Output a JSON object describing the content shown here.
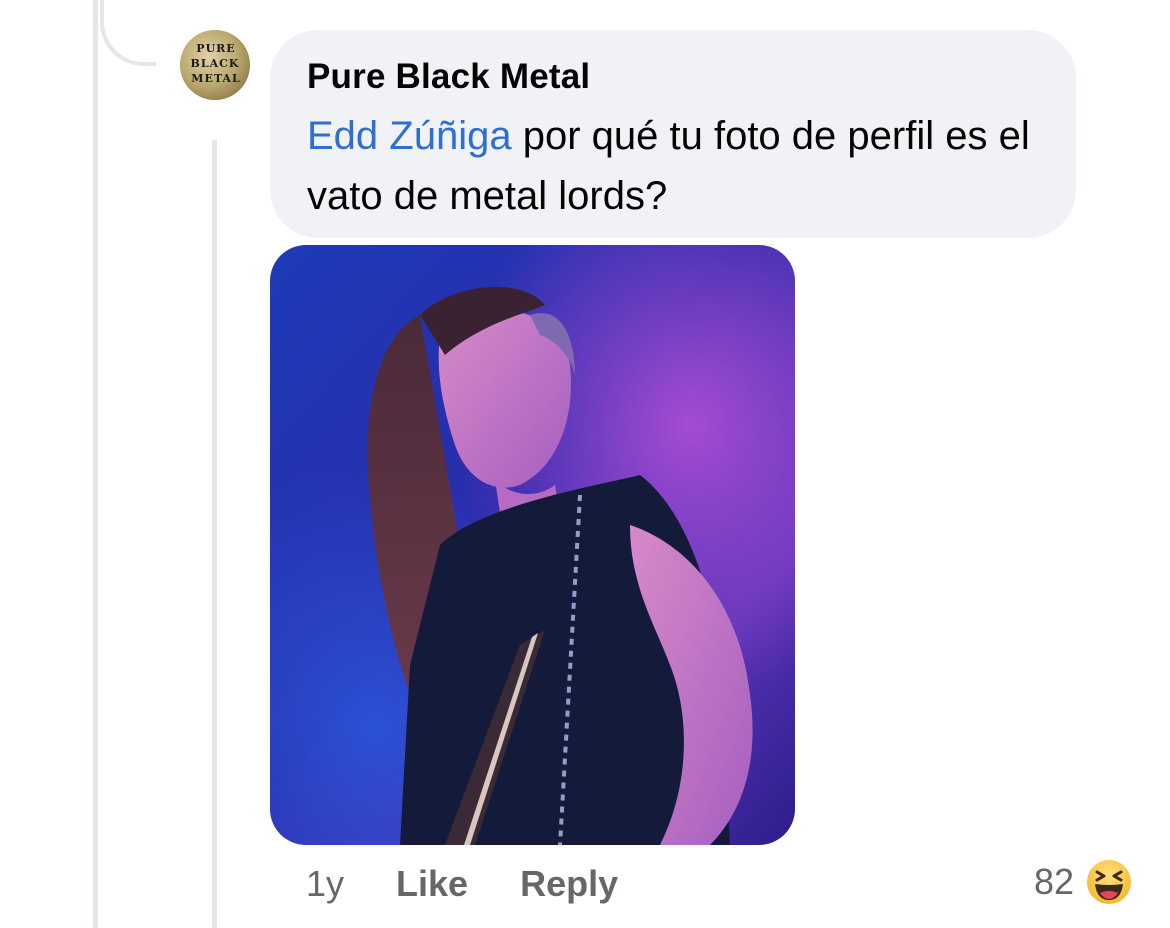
{
  "comment": {
    "author": "Pure Black Metal",
    "avatar_text": [
      "PURE",
      "BLACK",
      "METAL"
    ],
    "mention": "Edd Zúñiga",
    "text_after_mention": " por qué tu foto de perfil es el vato de metal lords?",
    "attachment": {
      "type": "photo",
      "colors": {
        "background": "#2a1f8f",
        "accent": "#8a3fd0"
      }
    }
  },
  "actions": {
    "time": "1y",
    "like_label": "Like",
    "reply_label": "Reply"
  },
  "reactions": {
    "count": "82",
    "icon": "haha-emoji-icon"
  },
  "colors": {
    "mention": "#2e6fd1",
    "bubble": "#f0f2f5",
    "secondary_text": "#65676b"
  }
}
